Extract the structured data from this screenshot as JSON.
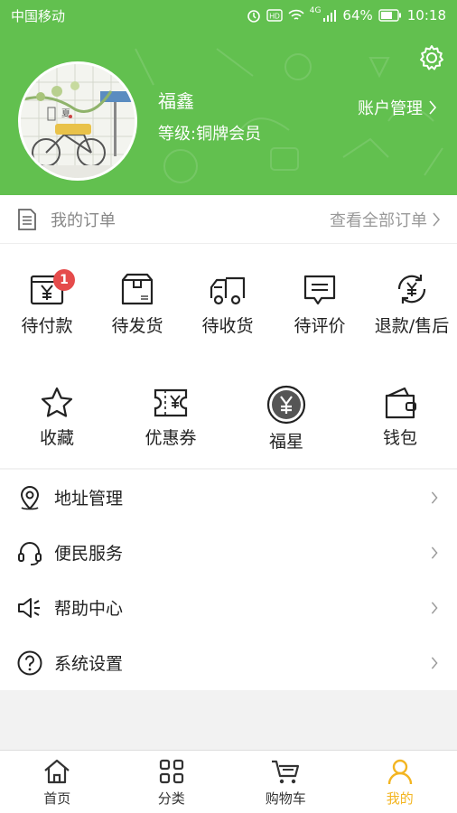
{
  "status_bar": {
    "carrier": "中国移动",
    "signal_tag": "4G",
    "battery": "64%",
    "time": "10:18"
  },
  "profile": {
    "name": "福鑫",
    "level": "等级:铜牌会员",
    "account_link": "账户管理"
  },
  "orders": {
    "title": "我的订单",
    "view_all": "查看全部订单",
    "items": [
      {
        "label": "待付款",
        "icon": "wallet-yuan-icon",
        "badge": "1"
      },
      {
        "label": "待发货",
        "icon": "package-box-icon"
      },
      {
        "label": "待收货",
        "icon": "delivery-truck-icon"
      },
      {
        "label": "待评价",
        "icon": "comment-icon"
      },
      {
        "label": "退款/售后",
        "icon": "refund-yuan-icon"
      }
    ]
  },
  "assets": [
    {
      "label": "收藏",
      "icon": "star-icon"
    },
    {
      "label": "优惠券",
      "icon": "coupon-icon"
    },
    {
      "label": "福星",
      "icon": "coin-yuan-icon"
    },
    {
      "label": "钱包",
      "icon": "wallet-icon"
    }
  ],
  "menu": [
    {
      "label": "地址管理",
      "icon": "location-pin-icon"
    },
    {
      "label": "便民服务",
      "icon": "headset-icon"
    },
    {
      "label": "帮助中心",
      "icon": "speaker-icon"
    },
    {
      "label": "系统设置",
      "icon": "question-circle-icon"
    }
  ],
  "tabbar": [
    {
      "label": "首页",
      "icon": "home-icon",
      "active": false
    },
    {
      "label": "分类",
      "icon": "grid-icon",
      "active": false
    },
    {
      "label": "购物车",
      "icon": "cart-icon",
      "active": false
    },
    {
      "label": "我的",
      "icon": "user-icon",
      "active": true
    }
  ],
  "colors": {
    "header_green": "#62c04f",
    "badge_red": "#e54b4b",
    "active_tab": "#f3b521"
  }
}
